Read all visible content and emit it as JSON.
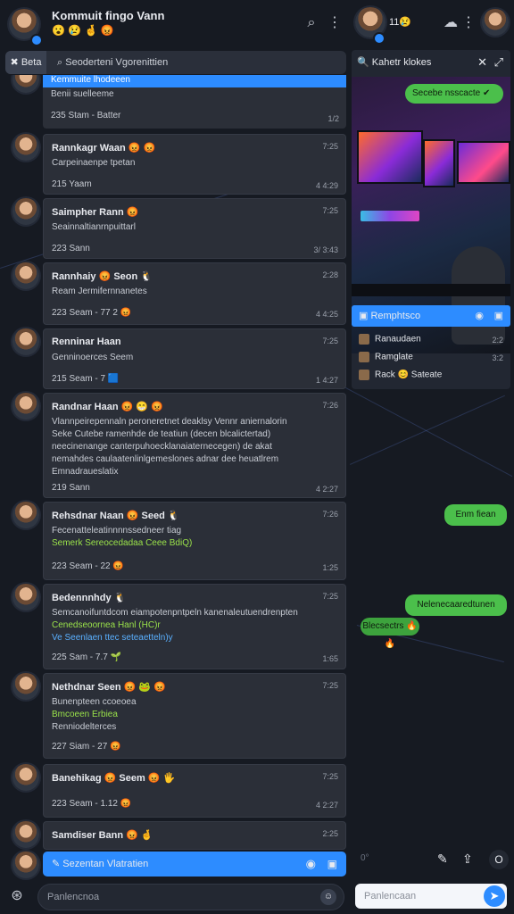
{
  "header": {
    "title": "Kommuit fingo Vann",
    "status_emojis": "😮 😢 🤞 😡",
    "right_emojis": "11😢",
    "search_icon": "search-icon",
    "more_icon": "kebab-icon"
  },
  "searchbar": {
    "chip": "Beta",
    "text": "Seoderteni Vgorenittien"
  },
  "right_panel": {
    "title": "Kahetr klokes",
    "overlay_label": "Secebe nsscacte",
    "blue_label": "Remphtsco",
    "members": [
      {
        "name": "Ranaudaen",
        "time": "2:2"
      },
      {
        "name": "Ramglate",
        "time": "3:2"
      },
      {
        "name": "Rack  😊  Sateate",
        "time": ""
      }
    ]
  },
  "messages": [
    {
      "id": "m0",
      "name": "Kemmuite lhodeeen",
      "lines": [
        "Benii suelleeme"
      ],
      "meta": "235 Stam  - Batter",
      "ticks": "1/2"
    },
    {
      "id": "m1",
      "name": "Rannkagr Waan 😡 😡",
      "time": "7:25",
      "lines": [
        "Carpeinaenpe tpetan"
      ],
      "meta": "215 Yaam",
      "ticks": "4  4:29"
    },
    {
      "id": "m2",
      "name": "Saimpher Rann 😡",
      "time": "7:25",
      "lines": [
        "Seainnaltianrnpuittarl"
      ],
      "meta": "223 Sann",
      "ticks": "3/  3:43"
    },
    {
      "id": "m3",
      "name": "Rannhaiy 😡 Seon 🐧",
      "time": "2:28",
      "lines": [
        "Ream Jermifernnanetes"
      ],
      "meta": "223 Seam - 77 2   😡",
      "ticks": "4  4:25"
    },
    {
      "id": "m4",
      "name": "Renninar Haan",
      "time": "7:25",
      "lines": [
        "Genninoerces Seem"
      ],
      "meta": "215 Seam - 7 🟦",
      "ticks": "1  4:27"
    },
    {
      "id": "m5",
      "name": "Randnar Haan 😡 😁 😡",
      "time": "7:26",
      "lines": [
        "Vlannpeirepennaln peroneretnet deaklsy Vennr aniernalorin",
        "Seke Cutebe ramenhde de teatiun (decen blcalictertad)",
        "neecinenange canterpuhoecklanaiaternecegen) de akat",
        "nemahdes caulaatenlinlgemeslones adnar dee heuatlrem",
        "Emnadraueslatix"
      ],
      "meta": "219 Sann",
      "ticks": "4  2:27"
    },
    {
      "id": "m6",
      "name": "Rehsdnar Naan 😡 Seed 🐧",
      "time": "7:26",
      "lines": [
        "Fecenatteleatinnnnssedneer tiag",
        "Semerk Sereocedadaa Ceee BdiQ)"
      ],
      "meta": "223 Seam - 22  😡",
      "ticks": "1:25"
    },
    {
      "id": "m7",
      "name": "Bedennnhdy 🐧",
      "time": "7:25",
      "lines": [
        "Semcanoifuntdcom eiampotenpntpeln kanenaleutuendrenpten",
        "Cenedseoornea Hanl (HC)r",
        "Ve Seenlaen ttec seteaetteln)y"
      ],
      "meta": "225 Sam - 7.7  🌱",
      "ticks": "1:65"
    },
    {
      "id": "m8",
      "name": "Nethdnar Seen 😡 🐸 😡",
      "time": "7:25",
      "lines": [
        "Bunenpteen ccoeoea",
        "Bmcoeen Erbiea",
        "Renniodelterces"
      ],
      "meta": "227 Siam - 27  😡",
      "ticks": ""
    },
    {
      "id": "m9",
      "name": "Banehikag 😡 Seem 😡 🖐",
      "time": "7:25",
      "lines": [],
      "meta": "223 Seam - 1.12  😡",
      "ticks": "4  2:27"
    },
    {
      "id": "m10",
      "name": "Samdiser Bann 😡 🤞",
      "time": "2:25",
      "lines": [],
      "meta": "",
      "ticks": ""
    }
  ],
  "compose_left": "Sezentan Vlatratien",
  "input_left_placeholder": "Panlencnoa",
  "bubbles": [
    {
      "text": "Enm fiean"
    },
    {
      "text": "Nelenecaaredtunen"
    },
    {
      "text": "Blecsectrs 🔥🔥"
    }
  ],
  "input_right_placeholder": "Panlencaan",
  "right_bottom": {
    "left": "0°",
    "right": "O"
  }
}
